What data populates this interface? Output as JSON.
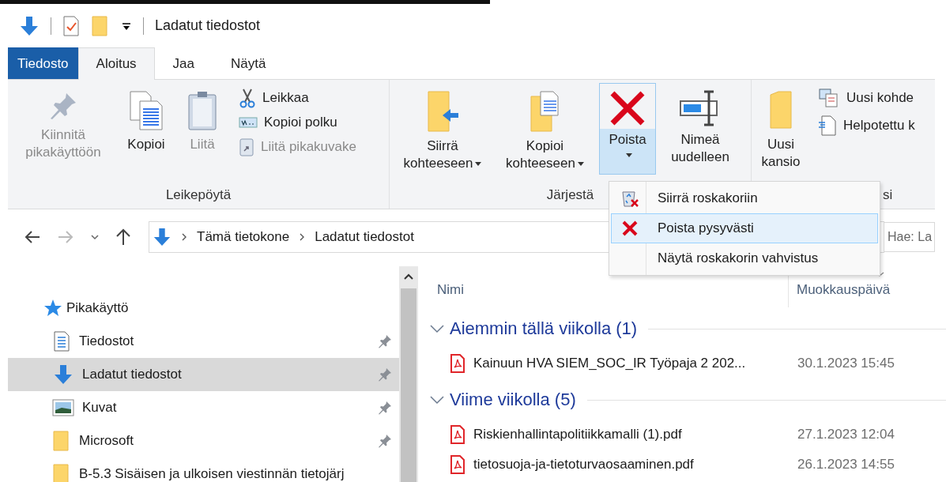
{
  "title_bar": {
    "title": "Ladatut tiedostot"
  },
  "ribbon_tabs": [
    {
      "label": "Tiedosto",
      "kind": "file",
      "selected": false
    },
    {
      "label": "Aloitus",
      "kind": "tab",
      "selected": true
    },
    {
      "label": "Jaa",
      "kind": "tab",
      "selected": false
    },
    {
      "label": "Näytä",
      "kind": "tab",
      "selected": false
    }
  ],
  "ribbon": {
    "clipboard": {
      "label": "Leikepöytä",
      "pin": {
        "label": "Kiinnitä pikakäyttöön",
        "disabled": true
      },
      "copy": {
        "label": "Kopioi",
        "disabled": false
      },
      "paste": {
        "label": "Liitä",
        "disabled": true
      },
      "cut": {
        "label": "Leikkaa",
        "disabled": false
      },
      "copy_path": {
        "label": "Kopioi polku",
        "disabled": false
      },
      "paste_shortcut": {
        "label": "Liitä pikakuvake",
        "disabled": true
      }
    },
    "organize": {
      "label": "Järjestä",
      "move_to": {
        "label": "Siirrä kohteeseen"
      },
      "copy_to": {
        "label": "Kopioi kohteeseen"
      },
      "delete": {
        "label": "Poista",
        "expanded": true
      },
      "rename": {
        "label": "Nimeä uudelleen"
      }
    },
    "new": {
      "label": "si",
      "new_folder": {
        "label": "Uusi kansio"
      },
      "new_item": {
        "label": "Uusi kohde"
      },
      "easy_access": {
        "label": "Helpotettu k"
      }
    }
  },
  "delete_menu": [
    {
      "label": "Siirrä roskakoriin",
      "kind": "recycle",
      "selected": false
    },
    {
      "label": "Poista pysyvästi",
      "kind": "delete",
      "selected": true
    },
    {
      "label": "Näytä roskakorin vahvistus",
      "kind": "plain",
      "selected": false
    }
  ],
  "address_bar": {
    "path": [
      "Tämä tietokone",
      "Ladatut tiedostot"
    ]
  },
  "search": {
    "placeholder": "Hae: La"
  },
  "navigation": [
    {
      "label": "Pikakäyttö",
      "kind": "quick-access",
      "children": [
        {
          "label": "Tiedostot",
          "kind": "documents",
          "pinned": true,
          "selected": false
        },
        {
          "label": "Ladatut tiedostot",
          "kind": "downloads",
          "pinned": true,
          "selected": true
        },
        {
          "label": "Kuvat",
          "kind": "pictures",
          "pinned": true,
          "selected": false
        },
        {
          "label": "Microsoft",
          "kind": "folder",
          "pinned": true,
          "selected": false
        },
        {
          "label": "B-5.3 Sisäisen ja ulkoisen viestinnän tietojärj",
          "kind": "folder",
          "pinned": false,
          "selected": false
        }
      ]
    }
  ],
  "file_list": {
    "columns": [
      "Nimi",
      "Muokkauspäivä"
    ],
    "groups": [
      {
        "title": "Aiemmin tällä viikolla (1)",
        "expanded": true,
        "files": [
          {
            "name": "Kainuun HVA SIEM_SOC_IR Työpaja 2 202...",
            "modified": "30.1.2023 15:45"
          }
        ]
      },
      {
        "title": "Viime viikolla (5)",
        "expanded": true,
        "files": [
          {
            "name": "Riskienhallintapolitiikkamalli (1).pdf",
            "modified": "27.1.2023 12:04"
          },
          {
            "name": "tietosuoja-ja-tietoturvaosaaminen.pdf",
            "modified": "26.1.2023 14:55"
          }
        ]
      }
    ]
  }
}
